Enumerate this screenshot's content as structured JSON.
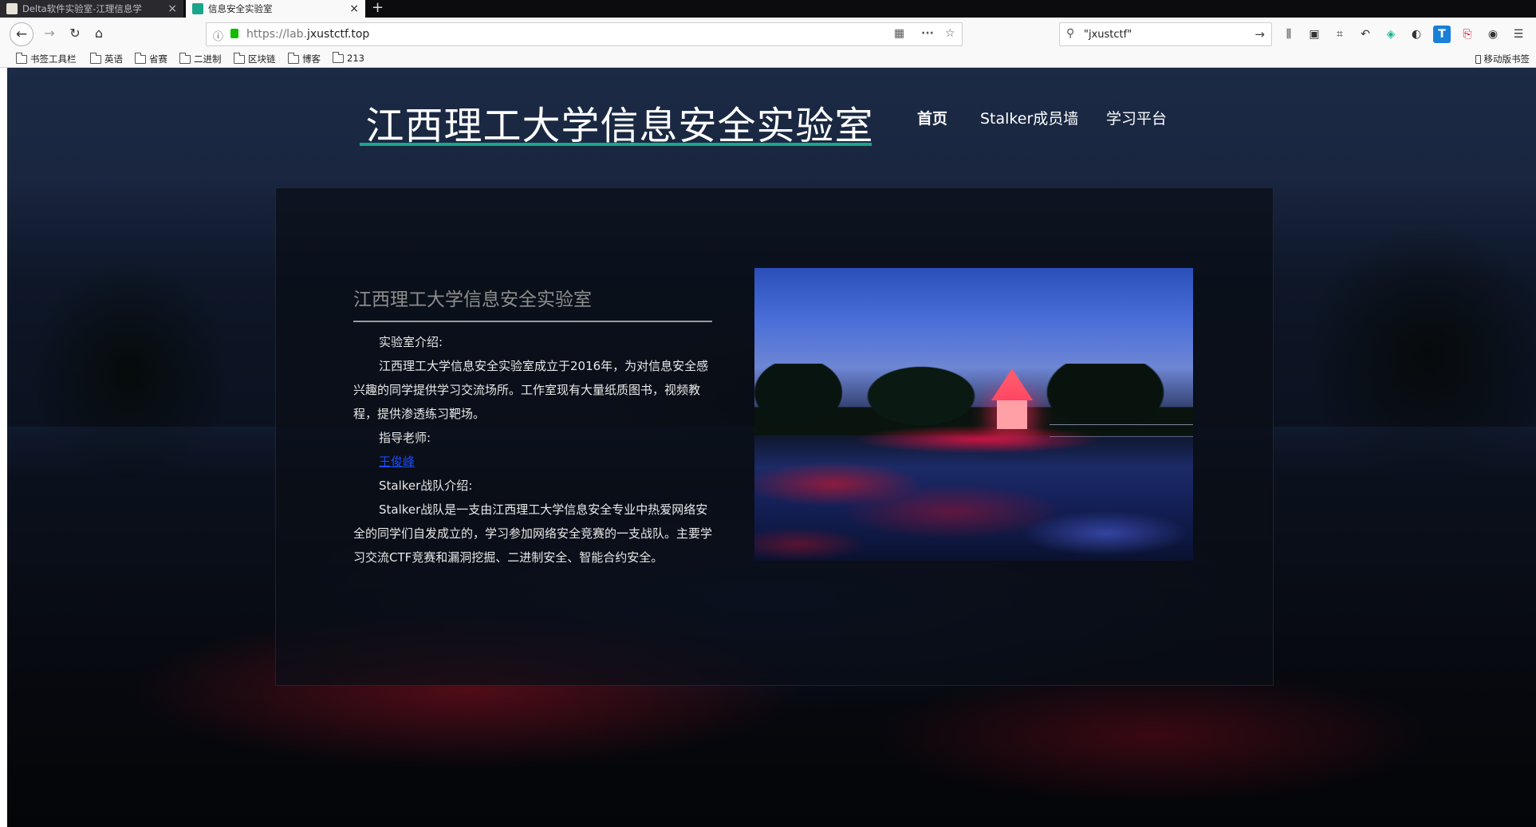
{
  "browser": {
    "tabs": [
      {
        "title": "Delta软件实验室-江理信息学",
        "active": false
      },
      {
        "title": "信息安全实验室",
        "active": true
      }
    ],
    "new_tab": "+",
    "url_prefix": "https://lab.",
    "url_host": "jxustctf.top",
    "search_query": "\"jxustctf\"",
    "bookmarks": [
      "书签工具栏",
      "英语",
      "省赛",
      "二进制",
      "区块链",
      "博客",
      "213"
    ],
    "mobile_bookmarks": "移动版书签"
  },
  "site": {
    "title": "江西理工大学信息安全实验室",
    "nav": {
      "home": "首页",
      "wall": "Stalker成员墙",
      "study": "学习平台"
    },
    "accent_color": "#1aa58a"
  },
  "panel": {
    "title": "江西理工大学信息安全实验室",
    "lab_intro_heading": "实验室介绍:",
    "lab_intro_text": "江西理工大学信息安全实验室成立于2016年，为对信息安全感兴趣的同学提供学习交流场所。工作室现有大量纸质图书，视频教程，提供渗透练习靶场。",
    "teacher_heading": "指导老师:",
    "teacher_name": "王俊峰",
    "team_heading": "Stalker战队介绍:",
    "team_text": "Stalker战队是一支由江西理工大学信息安全专业中热爱网络安全的同学们自发成立的，学习参加网络安全竞赛的一支战队。主要学习交流CTF竞赛和漏洞挖掘、二进制安全、智能合约安全。"
  }
}
